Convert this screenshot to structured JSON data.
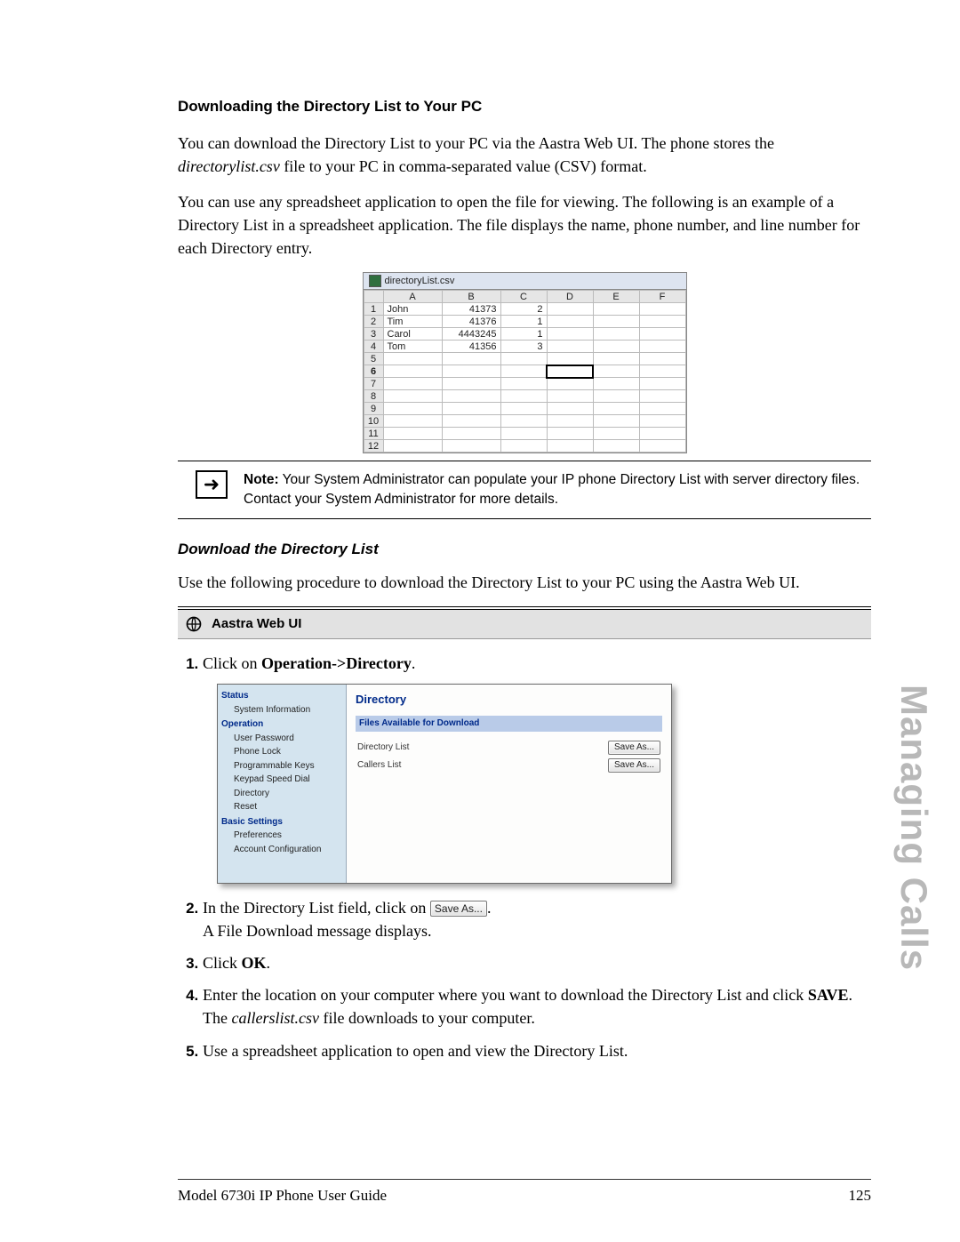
{
  "headings": {
    "section": "Downloading the Directory List to Your PC",
    "subsection": "Download the Directory List"
  },
  "paragraphs": {
    "p1a": "You can download the Directory List to your PC via the Aastra Web UI. The phone stores the ",
    "p1b_italic": "directorylist.csv",
    "p1c": " file to your PC in comma-separated value (CSV) format.",
    "p2": "You can use any spreadsheet application to open the file for viewing. The following is an example of a Directory List in a spreadsheet application. The file displays the name, phone number, and line number for each Directory entry.",
    "p3": "Use the following procedure to download the Directory List to your PC using the Aastra Web UI."
  },
  "spreadsheet": {
    "filename": "directoryList.csv",
    "cols": [
      "A",
      "B",
      "C",
      "D",
      "E",
      "F"
    ],
    "rows": [
      {
        "n": "1",
        "a": "John",
        "b": "41373",
        "c": "2"
      },
      {
        "n": "2",
        "a": "Tim",
        "b": "41376",
        "c": "1"
      },
      {
        "n": "3",
        "a": "Carol",
        "b": "4443245",
        "c": "1"
      },
      {
        "n": "4",
        "a": "Tom",
        "b": "41356",
        "c": "3"
      },
      {
        "n": "5"
      },
      {
        "n": "6"
      },
      {
        "n": "7"
      },
      {
        "n": "8"
      },
      {
        "n": "9"
      },
      {
        "n": "10"
      },
      {
        "n": "11"
      },
      {
        "n": "12"
      }
    ]
  },
  "note": {
    "label": "Note:",
    "text": " Your System Administrator can populate your IP phone Directory List with server directory files. Contact your System Administrator for more details."
  },
  "webui_bar": "Aastra Web UI",
  "steps": {
    "s1a": "Click on ",
    "s1b_bold": "Operation->Directory",
    "s1c": ".",
    "s2a": "In the Directory List field, click on ",
    "s2_btn": "Save As...",
    "s2b": ".",
    "s2c": "A File Download message displays.",
    "s3a": "Click ",
    "s3b_bold": "OK",
    "s3c": ".",
    "s4a": "Enter the location on your computer where you want to download the Directory List and click ",
    "s4b_bold": "SAVE",
    "s4c": ".",
    "s4d": "The ",
    "s4e_italic": "callerslist.csv",
    "s4f": " file downloads to your computer.",
    "s5": "Use a spreadsheet application to open and view the Directory List."
  },
  "webui_shot": {
    "sidebar": {
      "status": "Status",
      "status_items": [
        "System Information"
      ],
      "operation": "Operation",
      "operation_items": [
        "User Password",
        "Phone Lock",
        "Programmable Keys",
        "Keypad Speed Dial",
        "Directory",
        "Reset"
      ],
      "basic": "Basic Settings",
      "basic_items": [
        "Preferences",
        "Account Configuration"
      ]
    },
    "main": {
      "title": "Directory",
      "files_header": "Files Available for Download",
      "rows": [
        {
          "label": "Directory List",
          "btn": "Save As..."
        },
        {
          "label": "Callers List",
          "btn": "Save As..."
        }
      ]
    }
  },
  "footer": {
    "left": "Model 6730i IP Phone User Guide",
    "right": "125"
  },
  "side_tab": "Managing Calls"
}
